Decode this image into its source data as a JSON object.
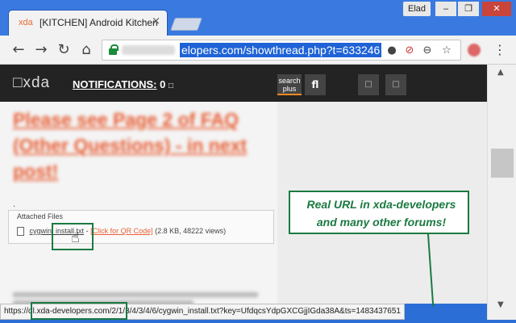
{
  "window": {
    "user": "Elad",
    "minimize": "–",
    "maximize": "❐",
    "close": "✕"
  },
  "tab": {
    "favicon": "xda",
    "title": "[KITCHEN] Android Kitchen",
    "close": "×"
  },
  "toolbar": {
    "back": "←",
    "forward": "→",
    "reload": "↻",
    "home": "⌂",
    "url_visible": "elopers.com/showthread.php?t=633246",
    "menu": "⋮"
  },
  "xda_bar": {
    "logo": "□xda",
    "notifications_label": "NOTIFICATIONS:",
    "notifications_count": "0",
    "search_plus": "search plus",
    "fl_label": "fl",
    "btn1": "□",
    "btn2": "□"
  },
  "post": {
    "title_blurred": "Please see Page 2 of FAQ (Other Questions) - in next post!",
    "dot": ".",
    "attached_files_label": "Attached Files",
    "file_name": "cygwin_install.txt",
    "qr_link": "[Click for QR Code]",
    "file_meta": "(2.8 KB, 48222 views)",
    "separator": "-"
  },
  "annotation": {
    "text": "Real URL in xda-developers and many other forums!"
  },
  "status_bar": {
    "url": "https://dl.xda-developers.com/2/1/3/4/3/4/6/cygwin_install.txt?key=UfdqcsYdpGXCGjjIGda38A&ts=1483437651"
  },
  "colors": {
    "accent_green": "#1b7a42",
    "link_orange": "#e85f36",
    "selection_blue": "#1f63d6"
  }
}
